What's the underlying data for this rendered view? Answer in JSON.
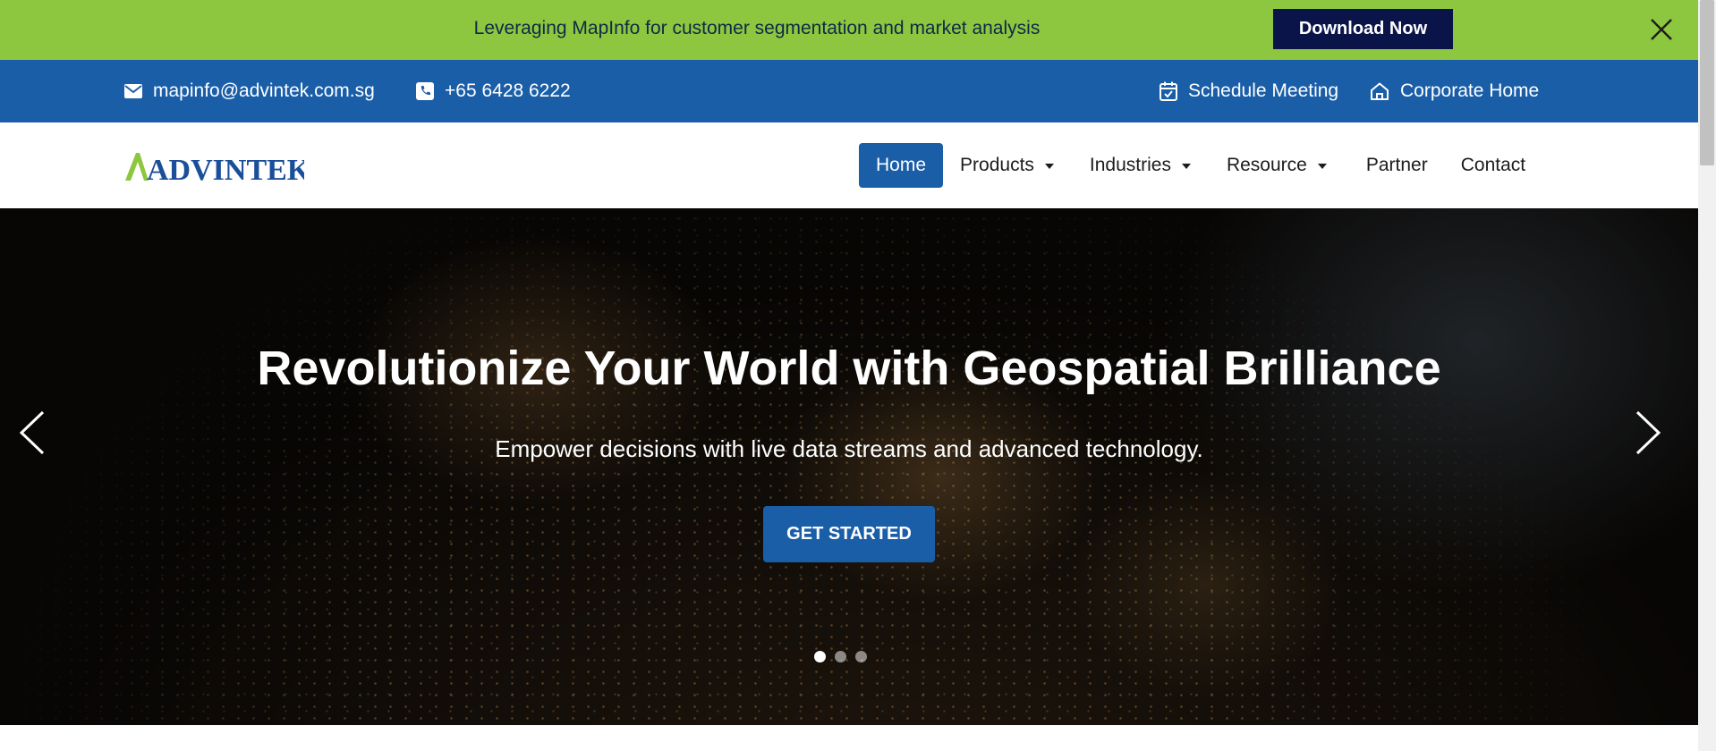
{
  "promo": {
    "text": "Leveraging MapInfo for customer segmentation and market analysis",
    "button": "Download Now",
    "bg": "#8dc63f"
  },
  "contact": {
    "email": "mapinfo@advintek.com.sg",
    "phone": "+65 6428 6222",
    "schedule": "Schedule Meeting",
    "corporate": "Corporate Home",
    "bg": "#1a5ea8"
  },
  "header": {
    "logo": "ADVINTEK",
    "nav": [
      {
        "label": "Home",
        "active": true
      },
      {
        "label": "Products",
        "dropdown": true
      },
      {
        "label": "Industries",
        "dropdown": true
      },
      {
        "label": "Resource",
        "dropdown": true
      },
      {
        "label": "Partner"
      },
      {
        "label": "Contact"
      }
    ]
  },
  "hero": {
    "title": "Revolutionize Your World with Geospatial Brilliance",
    "subtitle": "Empower decisions with live data streams and advanced technology.",
    "cta": "GET STARTED",
    "slides": 3,
    "active_slide": 1
  },
  "colors": {
    "brand_blue": "#1a5ea8",
    "brand_green": "#8dc63f",
    "dark_navy": "#0b1449"
  }
}
